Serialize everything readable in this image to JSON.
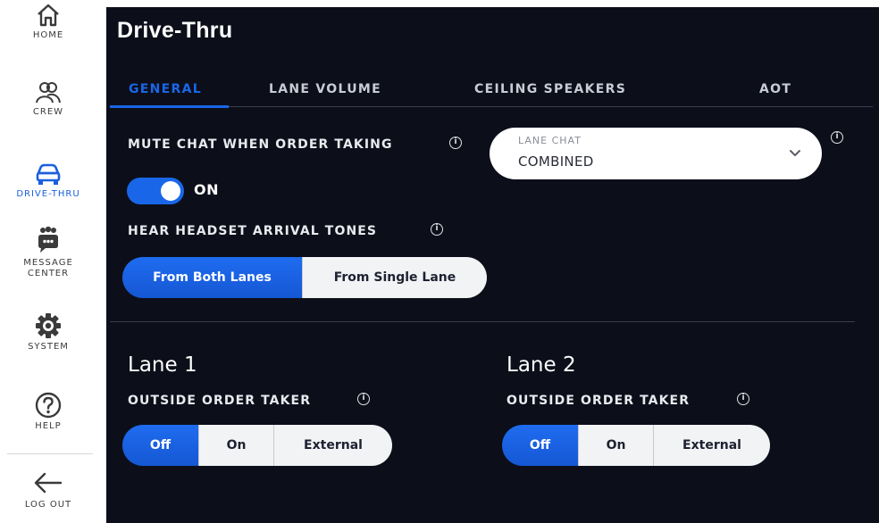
{
  "sidebar": {
    "items": [
      {
        "label": "HOME",
        "icon": "home-icon"
      },
      {
        "label": "CREW",
        "icon": "crew-icon"
      },
      {
        "label": "DRIVE-THRU",
        "icon": "car-icon"
      },
      {
        "label_line1": "MESSAGE",
        "label_line2": "CENTER",
        "icon": "chat-icon"
      },
      {
        "label": "SYSTEM",
        "icon": "gear-icon"
      },
      {
        "label": "HELP",
        "icon": "help-icon"
      },
      {
        "label": "LOG OUT",
        "icon": "arrow-left-icon"
      }
    ],
    "active": "DRIVE-THRU"
  },
  "header": {
    "title": "Drive-Thru"
  },
  "tabs": [
    {
      "label": "GENERAL",
      "active": true
    },
    {
      "label": "LANE VOLUME",
      "active": false
    },
    {
      "label": "CEILING SPEAKERS",
      "active": false
    },
    {
      "label": "AOT",
      "active": false
    }
  ],
  "general": {
    "mute_chat_label": "MUTE CHAT WHEN ORDER TAKING",
    "mute_chat_state": "ON",
    "arrival_tones_label": "HEAR HEADSET ARRIVAL TONES",
    "arrival_tones_options": [
      "From Both Lanes",
      "From Single Lane"
    ],
    "arrival_tones_selected": "From Both Lanes",
    "lane_chat": {
      "label": "LANE CHAT",
      "value": "COMBINED"
    }
  },
  "lanes": [
    {
      "title": "Lane 1",
      "oot_label": "OUTSIDE ORDER TAKER",
      "options": [
        "Off",
        "On",
        "External"
      ],
      "selected": "Off"
    },
    {
      "title": "Lane 2",
      "oot_label": "OUTSIDE ORDER TAKER",
      "options": [
        "Off",
        "On",
        "External"
      ],
      "selected": "Off"
    }
  ],
  "info_glyph": "i",
  "colors": {
    "accent": "#1a66e8",
    "panel_bg": "#0c0f1a"
  }
}
